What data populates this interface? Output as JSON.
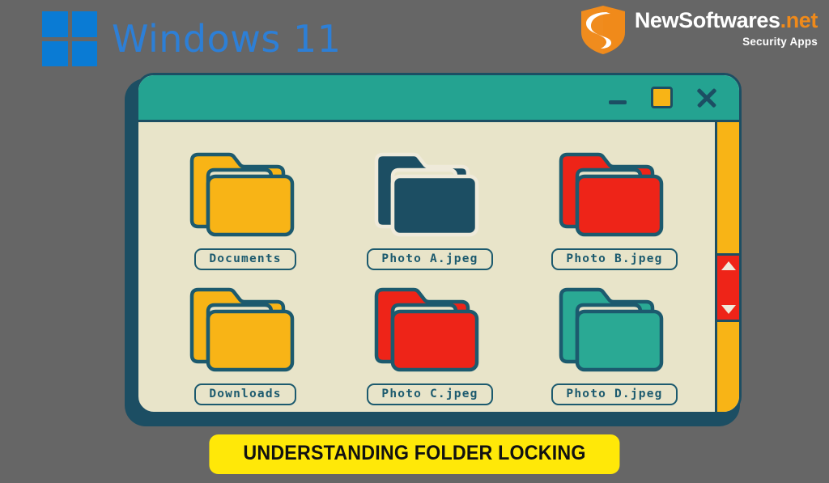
{
  "background_color": "#666666",
  "branding": {
    "windows": {
      "logo_icon": "windows-logo-icon",
      "logo_color": "#0a7bd4",
      "title": "Windows 11",
      "title_color": "#2d7fd6"
    },
    "vendor": {
      "shield_icon": "shield-s-logo-icon",
      "name_primary": "NewSoftwares",
      "name_suffix": ".net",
      "suffix_color": "#f08a1a",
      "tagline": "Security Apps"
    }
  },
  "window": {
    "titlebar_color": "#24a391",
    "body_color": "#e8e4c9",
    "outline_color": "#1c4e63",
    "controls": {
      "minimize_label": "Minimize",
      "maximize_label": "Maximize",
      "close_label": "Close",
      "maximize_color": "#f8b416"
    },
    "scrollbar": {
      "track_color": "#f8b416",
      "thumb_color": "#ee2418",
      "up_arrow_label": "Scroll up",
      "down_arrow_label": "Scroll down"
    },
    "files": [
      {
        "name": "Documents",
        "color": "#f8b416",
        "outline": "#1c5a6e",
        "style": "stacked"
      },
      {
        "name": "Photo A.jpeg",
        "color": "#1c4e63",
        "outline": "#efeada",
        "style": "stacked"
      },
      {
        "name": "Photo B.jpeg",
        "color": "#ee2418",
        "outline": "#1c5a6e",
        "style": "stacked"
      },
      {
        "name": "Downloads",
        "color": "#f8b416",
        "outline": "#1c5a6e",
        "style": "plain"
      },
      {
        "name": "Photo C.jpeg",
        "color": "#ee2418",
        "outline": "#1c5a6e",
        "style": "plain"
      },
      {
        "name": "Photo D.jpeg",
        "color": "#2aa994",
        "outline": "#1c5a6e",
        "style": "plain"
      }
    ]
  },
  "banner": {
    "text": "UNDERSTANDING FOLDER LOCKING",
    "background_color": "#ffe808",
    "text_color": "#111111"
  }
}
